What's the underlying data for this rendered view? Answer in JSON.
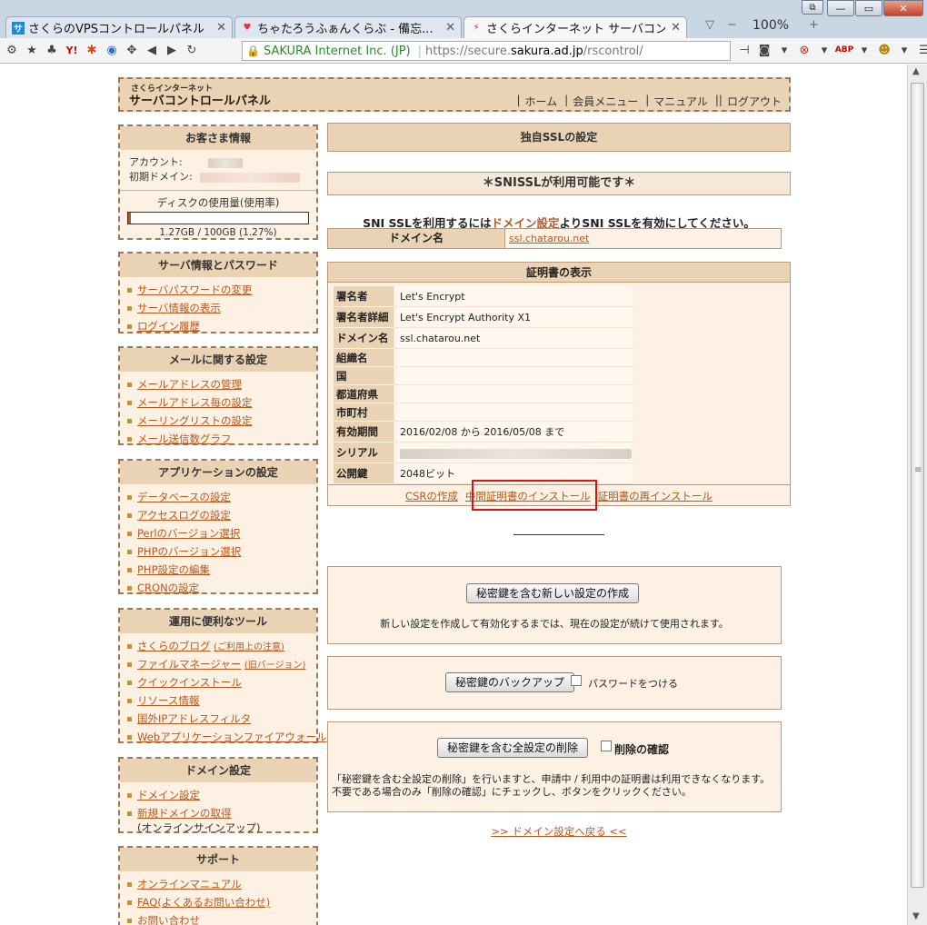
{
  "browser": {
    "tabs": [
      {
        "title": "さくらのVPSコントロールパネル",
        "icon": "sakura-vps-icon"
      },
      {
        "title": "ちゃたろうふぁんくらぶ - 備忘...",
        "icon": "heart-icon"
      },
      {
        "title": "さくらインターネット サーバコン...",
        "icon": "sakura-icon"
      }
    ],
    "zoom": "100%",
    "cert_org": "SAKURA Internet Inc. (JP)",
    "url_prefix": "https://secure.",
    "url_host": "sakura.ad.jp",
    "url_path": "/rscontrol/"
  },
  "header": {
    "logo_small": "さくらインターネット",
    "logo_main": "サーバコントロールパネル",
    "nav": [
      "ホーム",
      "会員メニュー",
      "マニュアル",
      "ログアウト"
    ]
  },
  "sidebar": {
    "customer": {
      "title": "お客さま情報",
      "account_label": "アカウント:",
      "domain_label": "初期ドメイン:",
      "disk_label": "ディスクの使用量(使用率)",
      "disk_usage": "1.27GB / 100GB (1.27%)",
      "disk_fraction": 0.0127
    },
    "server": {
      "title": "サーバ情報とパスワード",
      "items": [
        "サーバパスワードの変更",
        "サーバ情報の表示",
        "ログイン履歴"
      ]
    },
    "mail": {
      "title": "メールに関する設定",
      "items": [
        "メールアドレスの管理",
        "メールアドレス毎の設定",
        "メーリングリストの設定",
        "メール送信数グラフ"
      ]
    },
    "app": {
      "title": "アプリケーションの設定",
      "items": [
        "データベースの設定",
        "アクセスログの設定",
        "Perlのバージョン選択",
        "PHPのバージョン選択",
        "PHP設定の編集",
        "CRONの設定"
      ]
    },
    "tools": {
      "title": "運用に便利なツール",
      "items": [
        "さくらのブログ",
        "ファイルマネージャー",
        "クイックインストール",
        "リソース情報",
        "国外IPアドレスフィルタ",
        "Webアプリケーションファイアウォール"
      ],
      "blog_note": "(ご利用上の注意)",
      "fm_note": "(旧バージョン)"
    },
    "domain": {
      "title": "ドメイン設定",
      "items": [
        "ドメイン設定",
        "新規ドメインの取得"
      ],
      "sub": "(オンラインサインアップ)"
    },
    "support": {
      "title": "サポート",
      "items": [
        "オンラインマニュアル",
        "FAQ(よくあるお問い合わせ)",
        "お問い合わせ"
      ]
    }
  },
  "main": {
    "title": "独自SSLの設定",
    "sni_banner": "＊SNISSLが利用可能です＊",
    "sni_msg_pre": "SNI SSLを利用するには",
    "sni_msg_link": "ドメイン設定",
    "sni_msg_post": "よりSNI SSLを有効にしてください。",
    "domain_label": "ドメイン名",
    "domain_value": "ssl.chatarou.net",
    "cert": {
      "title": "証明書の表示",
      "rows": [
        {
          "k": "署名者",
          "v": "Let's Encrypt"
        },
        {
          "k": "署名者詳細",
          "v": "Let's Encrypt Authority X1"
        },
        {
          "k": "ドメイン名",
          "v": "ssl.chatarou.net"
        },
        {
          "k": "組織名",
          "v": ""
        },
        {
          "k": "国",
          "v": ""
        },
        {
          "k": "都道府県",
          "v": ""
        },
        {
          "k": "市町村",
          "v": ""
        },
        {
          "k": "有効期間",
          "v": "2016/02/08 から 2016/05/08 まで"
        },
        {
          "k": "シリアル",
          "v": ""
        },
        {
          "k": "公開鍵",
          "v": "2048ビット"
        }
      ],
      "link_csr": "CSRの作成",
      "link_intermediate": "中間証明書のインストール",
      "link_reinstall": "証明書の再インストール"
    },
    "new_button": "秘密鍵を含む新しい設定の作成",
    "new_note": "新しい設定を作成して有効化するまでは、現在の設定が続けて使用されます。",
    "backup_button": "秘密鍵のバックアップ",
    "password_label": "パスワードをつける",
    "delete_button": "秘密鍵を含む全設定の削除",
    "delete_confirm": "削除の確認",
    "delete_note_1": "「秘密鍵を含む全設定の削除」を行いますと、申請中 / 利用中の証明書は利用できなくなります。",
    "delete_note_2": "不要である場合のみ「削除の確認」にチェックし、ボタンをクリックください。",
    "back_link": ">> ドメイン設定へ戻る <<"
  }
}
